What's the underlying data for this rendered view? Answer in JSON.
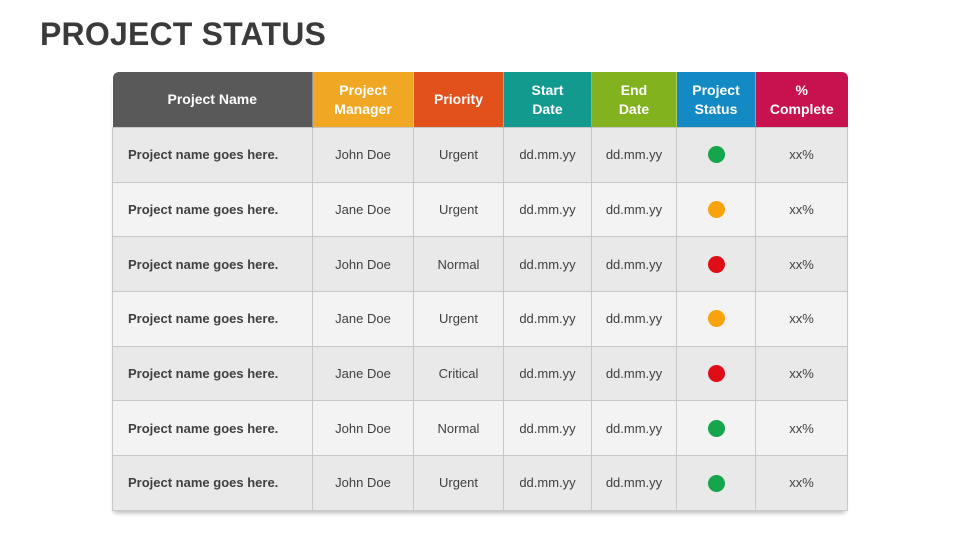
{
  "title": "PROJECT STATUS",
  "columns": [
    {
      "key": "name",
      "label": "Project Name",
      "color": "#595959"
    },
    {
      "key": "manager",
      "label": "Project\nManager",
      "color": "#f0a824"
    },
    {
      "key": "priority",
      "label": "Priority",
      "color": "#e2511c"
    },
    {
      "key": "start",
      "label": "Start\nDate",
      "color": "#139a8e"
    },
    {
      "key": "end",
      "label": "End\nDate",
      "color": "#82b21d"
    },
    {
      "key": "status",
      "label": "Project\nStatus",
      "color": "#138ac3"
    },
    {
      "key": "complete",
      "label": "%\nComplete",
      "color": "#c8124f"
    }
  ],
  "status_colors": {
    "green": "#15a54a",
    "orange": "#f7a30e",
    "red": "#df0e16"
  },
  "rows": [
    {
      "name": "Project name goes here.",
      "manager": "John Doe",
      "priority": "Urgent",
      "start": "dd.mm.yy",
      "end": "dd.mm.yy",
      "status": "green",
      "complete": "xx%"
    },
    {
      "name": "Project name goes here.",
      "manager": "Jane Doe",
      "priority": "Urgent",
      "start": "dd.mm.yy",
      "end": "dd.mm.yy",
      "status": "orange",
      "complete": "xx%"
    },
    {
      "name": "Project name goes here.",
      "manager": "John Doe",
      "priority": "Normal",
      "start": "dd.mm.yy",
      "end": "dd.mm.yy",
      "status": "red",
      "complete": "xx%"
    },
    {
      "name": "Project name goes here.",
      "manager": "Jane Doe",
      "priority": "Urgent",
      "start": "dd.mm.yy",
      "end": "dd.mm.yy",
      "status": "orange",
      "complete": "xx%"
    },
    {
      "name": "Project name goes here.",
      "manager": "Jane Doe",
      "priority": "Critical",
      "start": "dd.mm.yy",
      "end": "dd.mm.yy",
      "status": "red",
      "complete": "xx%"
    },
    {
      "name": "Project name goes here.",
      "manager": "John Doe",
      "priority": "Normal",
      "start": "dd.mm.yy",
      "end": "dd.mm.yy",
      "status": "green",
      "complete": "xx%"
    },
    {
      "name": "Project name goes here.",
      "manager": "John Doe",
      "priority": "Urgent",
      "start": "dd.mm.yy",
      "end": "dd.mm.yy",
      "status": "green",
      "complete": "xx%"
    }
  ]
}
